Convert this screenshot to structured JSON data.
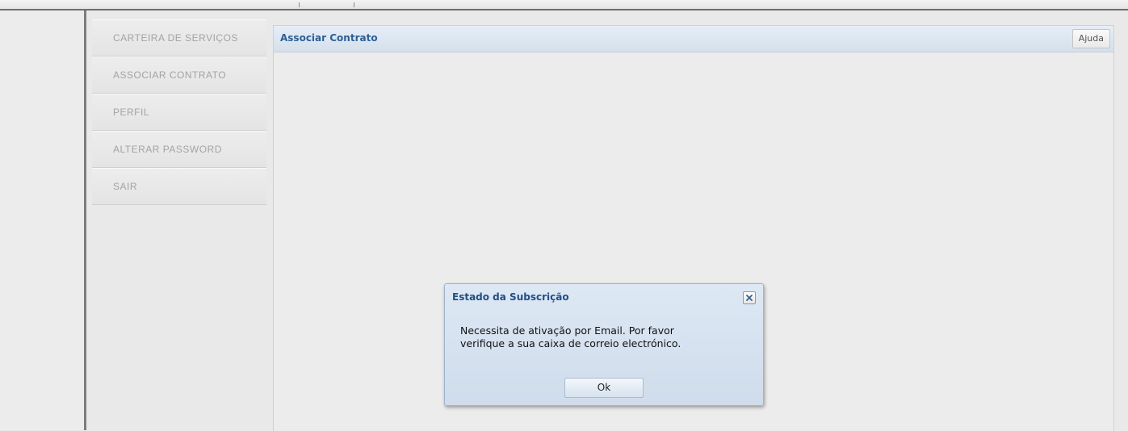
{
  "sidebar": {
    "items": [
      {
        "label": "CARTEIRA DE SERVIÇOS"
      },
      {
        "label": "ASSOCIAR CONTRATO"
      },
      {
        "label": "PERFIL"
      },
      {
        "label": "ALTERAR PASSWORD"
      },
      {
        "label": "SAIR"
      }
    ]
  },
  "panel": {
    "title": "Associar Contrato",
    "help_label": "Ajuda"
  },
  "dialog": {
    "title": "Estado da Subscrição",
    "message_line1": "Necessita de ativação por Email. Por favor",
    "message_line2": "verifique a sua caixa de correio electrónico.",
    "ok_label": "Ok",
    "close_icon": "close-icon"
  },
  "colors": {
    "accent": "#2e5f94",
    "sidebar_text": "#a3a3a3",
    "panel_header": "#d9e4ef"
  }
}
